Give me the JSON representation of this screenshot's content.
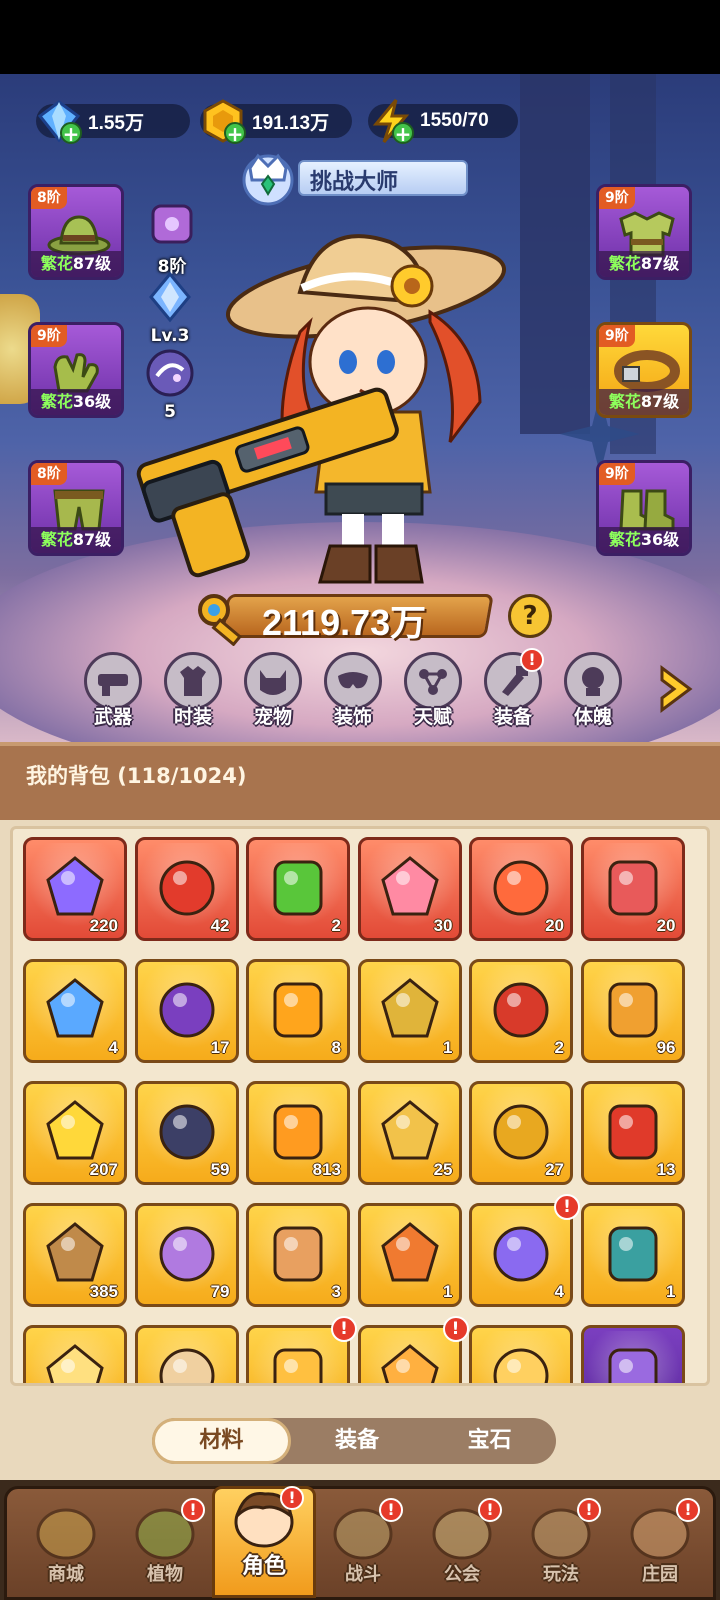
{
  "currencies": [
    {
      "name": "diamond-icon",
      "value": "1.55万"
    },
    {
      "name": "gold-coin-icon",
      "value": "191.13万"
    },
    {
      "name": "energy-icon",
      "value": "1550/70"
    }
  ],
  "banner": {
    "title": "挑战大师"
  },
  "left_slots": [
    {
      "tier": "8阶",
      "prefix": "繁花",
      "level": "87级",
      "icon": "hat-icon"
    },
    {
      "tier": "9阶",
      "prefix": "繁花",
      "level": "36级",
      "icon": "gloves-icon"
    },
    {
      "tier": "8阶",
      "prefix": "繁花",
      "level": "87级",
      "icon": "pants-icon"
    }
  ],
  "right_slots": [
    {
      "tier": "9阶",
      "prefix": "繁花",
      "level": "87级",
      "icon": "armor-icon"
    },
    {
      "tier": "9阶",
      "prefix": "繁花",
      "level": "87级",
      "icon": "belt-icon"
    },
    {
      "tier": "9阶",
      "prefix": "繁花",
      "level": "36级",
      "icon": "boots-icon"
    }
  ],
  "mid_icons": [
    {
      "icon": "pet-bag-icon",
      "caption": "8阶"
    },
    {
      "icon": "crystal-icon",
      "caption": "Lv.3"
    },
    {
      "icon": "orb-icon",
      "caption": "5"
    }
  ],
  "power": {
    "value": "2119.73万",
    "help": "?"
  },
  "functions": [
    {
      "label": "武器",
      "icon": "weapon-icon",
      "alert": false
    },
    {
      "label": "时装",
      "icon": "outfit-icon",
      "alert": false
    },
    {
      "label": "宠物",
      "icon": "pet-icon",
      "alert": false
    },
    {
      "label": "装饰",
      "icon": "mask-icon",
      "alert": false
    },
    {
      "label": "天赋",
      "icon": "talent-icon",
      "alert": false
    },
    {
      "label": "装备",
      "icon": "equipment-icon",
      "alert": true
    },
    {
      "label": "体魄",
      "icon": "physique-icon",
      "alert": false
    }
  ],
  "bag": {
    "title": "我的背包 (118/1024)",
    "items": [
      {
        "icon": "star-crystal-icon",
        "count": "220",
        "rarity": "red",
        "alert": false
      },
      {
        "icon": "fruit-potion-icon",
        "count": "42",
        "rarity": "red",
        "alert": false
      },
      {
        "icon": "green-tube-icon",
        "count": "2",
        "rarity": "red",
        "alert": false
      },
      {
        "icon": "flower-rune-icon",
        "count": "30",
        "rarity": "red",
        "alert": false
      },
      {
        "icon": "hero-shard-icon",
        "count": "20",
        "rarity": "red",
        "alert": false
      },
      {
        "icon": "hero-shard-icon",
        "count": "20",
        "rarity": "red",
        "alert": false
      },
      {
        "icon": "water-drop-icon",
        "count": "4",
        "rarity": "gold",
        "alert": false
      },
      {
        "icon": "skull-scroll-icon",
        "count": "17",
        "rarity": "gold",
        "alert": false
      },
      {
        "icon": "ruby-key-icon",
        "count": "8",
        "rarity": "gold",
        "alert": false
      },
      {
        "icon": "emerald-key-icon",
        "count": "1",
        "rarity": "gold",
        "alert": false
      },
      {
        "icon": "flame-leaf-icon",
        "count": "2",
        "rarity": "gold",
        "alert": false
      },
      {
        "icon": "pyramid-icon",
        "count": "96",
        "rarity": "gold",
        "alert": false
      },
      {
        "icon": "gold-flower-icon",
        "count": "207",
        "rarity": "gold",
        "alert": false
      },
      {
        "icon": "dark-rune-icon",
        "count": "59",
        "rarity": "gold",
        "alert": false
      },
      {
        "icon": "orange-potion-icon",
        "count": "813",
        "rarity": "gold",
        "alert": false
      },
      {
        "icon": "gold-pile-icon",
        "count": "25",
        "rarity": "gold",
        "alert": false
      },
      {
        "icon": "gold-ore-icon",
        "count": "27",
        "rarity": "gold",
        "alert": false
      },
      {
        "icon": "red-bloom-icon",
        "count": "13",
        "rarity": "gold",
        "alert": false
      },
      {
        "icon": "flower-pot-icon",
        "count": "385",
        "rarity": "gold",
        "alert": false
      },
      {
        "icon": "spell-book-icon",
        "count": "79",
        "rarity": "gold",
        "alert": false
      },
      {
        "icon": "jar-icon",
        "count": "3",
        "rarity": "gold",
        "alert": false
      },
      {
        "icon": "amber-gem-icon",
        "count": "1",
        "rarity": "gold",
        "alert": false
      },
      {
        "icon": "capsule-icon",
        "count": "4",
        "rarity": "gold",
        "alert": true
      },
      {
        "icon": "spool-icon",
        "count": "1",
        "rarity": "gold",
        "alert": false
      },
      {
        "icon": "item-icon",
        "count": "",
        "rarity": "gold",
        "alert": false
      },
      {
        "icon": "item-icon",
        "count": "",
        "rarity": "gold",
        "alert": false
      },
      {
        "icon": "item-icon",
        "count": "",
        "rarity": "gold",
        "alert": true
      },
      {
        "icon": "item-icon",
        "count": "",
        "rarity": "gold",
        "alert": true
      },
      {
        "icon": "item-icon",
        "count": "",
        "rarity": "gold",
        "alert": false
      },
      {
        "icon": "item-icon",
        "count": "",
        "rarity": "purple",
        "alert": false
      }
    ],
    "tabs": [
      {
        "label": "材料",
        "active": true
      },
      {
        "label": "装备",
        "active": false
      },
      {
        "label": "宝石",
        "active": false
      }
    ]
  },
  "nav": [
    {
      "label": "商城",
      "icon": "shop-icon",
      "alert": false,
      "active": false
    },
    {
      "label": "植物",
      "icon": "plant-icon",
      "alert": true,
      "active": false
    },
    {
      "label": "角色",
      "icon": "character-icon",
      "alert": true,
      "active": true
    },
    {
      "label": "战斗",
      "icon": "battle-icon",
      "alert": true,
      "active": false
    },
    {
      "label": "公会",
      "icon": "guild-icon",
      "alert": true,
      "active": false
    },
    {
      "label": "玩法",
      "icon": "gameplay-icon",
      "alert": true,
      "active": false
    },
    {
      "label": "庄园",
      "icon": "manor-icon",
      "alert": true,
      "active": false
    }
  ],
  "colors": {
    "gold_frame": "#f6ab1b",
    "red_frame": "#e24a37",
    "purple_frame": "#7b3fc0",
    "level_green": "#8dff5c"
  }
}
